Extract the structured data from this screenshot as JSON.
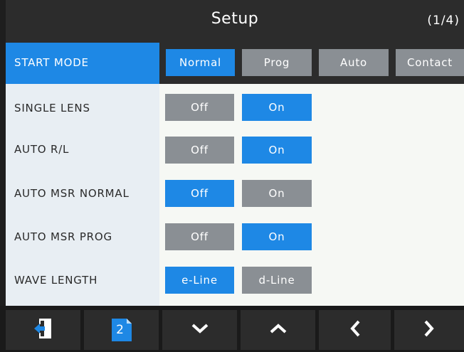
{
  "header": {
    "title": "Setup",
    "page": "(1/4)"
  },
  "start_mode": {
    "label": "START MODE",
    "options": [
      "Normal",
      "Prog",
      "Auto",
      "Contact"
    ],
    "selected": "Normal"
  },
  "settings": [
    {
      "label": "SINGLE LENS",
      "options": [
        "Off",
        "On"
      ],
      "selected": "On"
    },
    {
      "label": "AUTO R/L",
      "options": [
        "Off",
        "On"
      ],
      "selected": "On"
    },
    {
      "label": "AUTO MSR NORMAL",
      "options": [
        "Off",
        "On"
      ],
      "selected": "Off"
    },
    {
      "label": "AUTO MSR PROG",
      "options": [
        "Off",
        "On"
      ],
      "selected": "On"
    },
    {
      "label": "WAVE LENGTH",
      "options": [
        "e-Line",
        "d-Line"
      ],
      "selected": "e-Line"
    }
  ],
  "toolbar": {
    "page_badge": "2",
    "icons": [
      "exit-icon",
      "page-icon",
      "chevron-down-icon",
      "chevron-up-icon",
      "chevron-left-icon",
      "chevron-right-icon"
    ]
  },
  "colors": {
    "accent": "#1e88e5",
    "inactive": "#8a8f94",
    "dark": "#2c2c2c"
  }
}
